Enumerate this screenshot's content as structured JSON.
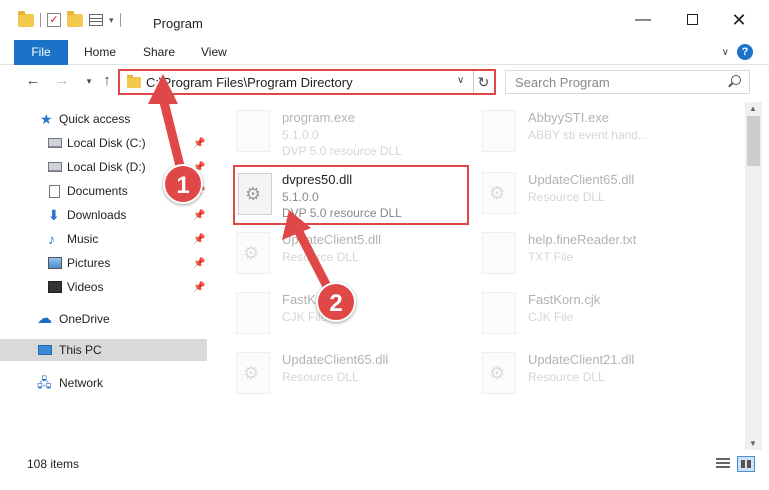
{
  "window": {
    "title": "Program",
    "min_glyph": "—",
    "close_glyph": "✕"
  },
  "ribbon": {
    "tabs": [
      "File",
      "Home",
      "Share",
      "View"
    ]
  },
  "address": {
    "path": "C:\\Program Files\\Program Directory",
    "search_placeholder": "Search Program"
  },
  "sidebar": {
    "items": [
      {
        "label": "Quick access",
        "icon": "star-icon",
        "pinned": false
      },
      {
        "label": "Local Disk (C:)",
        "icon": "drive-icon",
        "pinned": true
      },
      {
        "label": "Local Disk (D:)",
        "icon": "drive-icon",
        "pinned": true
      },
      {
        "label": "Documents",
        "icon": "documents-icon",
        "pinned": true
      },
      {
        "label": "Downloads",
        "icon": "downloads-icon",
        "pinned": true
      },
      {
        "label": "Music",
        "icon": "music-icon",
        "pinned": true
      },
      {
        "label": "Pictures",
        "icon": "pictures-icon",
        "pinned": true
      },
      {
        "label": "Videos",
        "icon": "videos-icon",
        "pinned": true
      },
      {
        "label": "OneDrive",
        "icon": "onedrive-icon",
        "pinned": false
      },
      {
        "label": "This PC",
        "icon": "this-pc-icon",
        "pinned": false,
        "selected": true
      },
      {
        "label": "Network",
        "icon": "network-icon",
        "pinned": false
      }
    ]
  },
  "files": [
    {
      "name": "program.exe",
      "line2": "5.1.0.0",
      "line3": "DVP 5.0 resource DLL"
    },
    {
      "name": "AbbyySTI.exe",
      "line2": "ABBY sti event hand...",
      "line3": ""
    },
    {
      "name": "dvpres50.dll",
      "line2": "5.1.0.0",
      "line3": "DVP 5.0 resource DLL"
    },
    {
      "name": "UpdateClient65.dll",
      "line2": "Resource DLL",
      "line3": ""
    },
    {
      "name": "UpdateClient5.dll",
      "line2": "Resource DLL",
      "line3": ""
    },
    {
      "name": "help.fineReader.txt",
      "line2": "TXT File",
      "line3": ""
    },
    {
      "name": "FastKor.cjk",
      "line2": "CJK File",
      "line3": ""
    },
    {
      "name": "FastKorn.cjk",
      "line2": "CJK File",
      "line3": ""
    },
    {
      "name": "UpdateClient65.dll",
      "line2": "Resource DLL",
      "line3": ""
    },
    {
      "name": "UpdateClient21.dll",
      "line2": "Resource DLL",
      "line3": ""
    }
  ],
  "status": {
    "item_count": "108 items"
  },
  "annotations": {
    "step1": "1",
    "step2": "2",
    "color": "#e04848"
  },
  "colors": {
    "accent": "#1a73c8",
    "highlight": "#e04848",
    "selected_nav": "#d9d9d9"
  }
}
